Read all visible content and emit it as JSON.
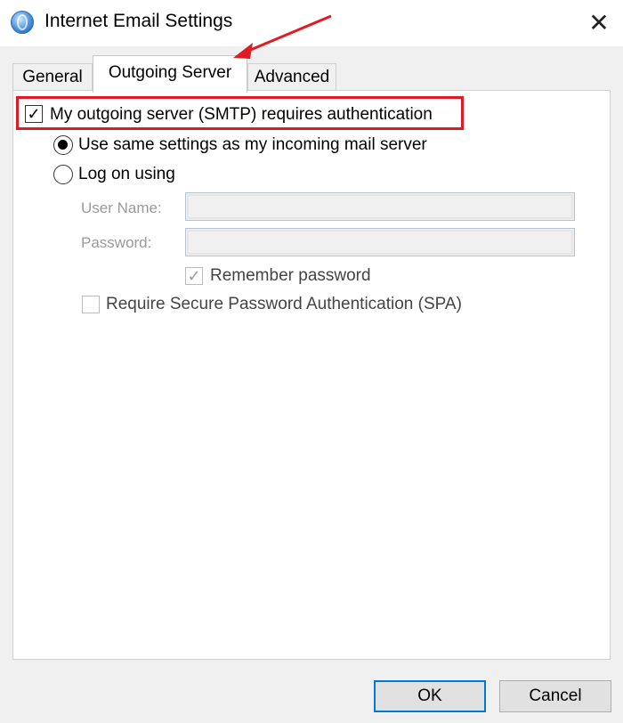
{
  "window": {
    "title": "Internet Email Settings",
    "close_glyph": "✕"
  },
  "tabs": [
    {
      "label": "General",
      "active": false
    },
    {
      "label": "Outgoing Server",
      "active": true
    },
    {
      "label": "Advanced",
      "active": false
    }
  ],
  "outgoing": {
    "smtp_auth_label": "My outgoing server (SMTP) requires authentication",
    "smtp_auth_checked": true,
    "use_same_label": "Use same settings as my incoming mail server",
    "use_same_selected": true,
    "log_on_label": "Log on using",
    "log_on_selected": false,
    "username_label": "User Name:",
    "username_value": "",
    "password_label": "Password:",
    "password_value": "",
    "remember_label": "Remember password",
    "remember_checked": true,
    "spa_label": "Require Secure Password Authentication (SPA)",
    "spa_checked": false
  },
  "buttons": {
    "ok": "OK",
    "cancel": "Cancel"
  },
  "annotation": {
    "highlight_color": "#e01b24",
    "arrow_color": "#e01b24"
  },
  "glyphs": {
    "check": "✓"
  }
}
